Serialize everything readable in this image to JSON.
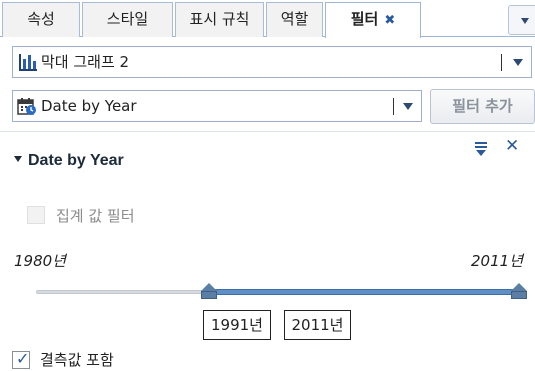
{
  "tabs": [
    {
      "label": "속성"
    },
    {
      "label": "스타일"
    },
    {
      "label": "표시 규칙"
    },
    {
      "label": "역할"
    },
    {
      "label": "필터",
      "close": "✖",
      "active": true
    }
  ],
  "object_selector": {
    "value": "막대 그래프 2",
    "icon": "bar-chart-icon"
  },
  "filter_selector": {
    "value": "Date by Year",
    "icon": "calendar-icon"
  },
  "add_filter_button": "필터 추가",
  "section": {
    "title": "Date by Year"
  },
  "aggregate_filter": {
    "label": "집계 값 필터",
    "checked": false,
    "enabled": false
  },
  "slider": {
    "min_label": "1980년",
    "max_label": "2011년",
    "range_min": 1980,
    "range_max": 2011,
    "selected_low": 1991,
    "selected_high": 2011,
    "low_box": "1991년",
    "high_box": "2011년"
  },
  "include_missing": {
    "label": "결측값 포함",
    "checked": true
  },
  "colors": {
    "accent": "#2a5a9c",
    "track_fill": "#5e8fc6"
  }
}
